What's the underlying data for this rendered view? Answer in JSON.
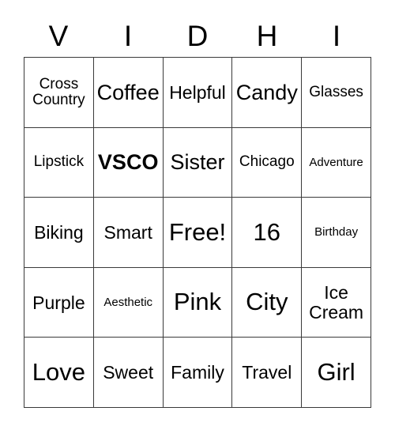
{
  "card": {
    "headers": [
      "V",
      "I",
      "D",
      "H",
      "I"
    ],
    "rows": [
      [
        {
          "label": "Cross\nCountry",
          "size": "sz-sm",
          "bold": false
        },
        {
          "label": "Coffee",
          "size": "sz-lg",
          "bold": false
        },
        {
          "label": "Helpful",
          "size": "sz-md",
          "bold": false
        },
        {
          "label": "Candy",
          "size": "sz-lg",
          "bold": false
        },
        {
          "label": "Glasses",
          "size": "sz-sm",
          "bold": false
        }
      ],
      [
        {
          "label": "Lipstick",
          "size": "sz-sm",
          "bold": false
        },
        {
          "label": "VSCO",
          "size": "sz-lg",
          "bold": true
        },
        {
          "label": "Sister",
          "size": "sz-lg",
          "bold": false
        },
        {
          "label": "Chicago",
          "size": "sz-sm",
          "bold": false
        },
        {
          "label": "Adventure",
          "size": "sz-xs",
          "bold": false
        }
      ],
      [
        {
          "label": "Biking",
          "size": "sz-md",
          "bold": false
        },
        {
          "label": "Smart",
          "size": "sz-md",
          "bold": false
        },
        {
          "label": "Free!",
          "size": "sz-xl",
          "bold": false
        },
        {
          "label": "16",
          "size": "sz-xl",
          "bold": false
        },
        {
          "label": "Birthday",
          "size": "sz-xs",
          "bold": false
        }
      ],
      [
        {
          "label": "Purple",
          "size": "sz-md",
          "bold": false
        },
        {
          "label": "Aesthetic",
          "size": "sz-xs",
          "bold": false
        },
        {
          "label": "Pink",
          "size": "sz-xl",
          "bold": false
        },
        {
          "label": "City",
          "size": "sz-xl",
          "bold": false
        },
        {
          "label": "Ice\nCream",
          "size": "sz-md",
          "bold": false
        }
      ],
      [
        {
          "label": "Love",
          "size": "sz-xl",
          "bold": false
        },
        {
          "label": "Sweet",
          "size": "sz-md",
          "bold": false
        },
        {
          "label": "Family",
          "size": "sz-md",
          "bold": false
        },
        {
          "label": "Travel",
          "size": "sz-md",
          "bold": false
        },
        {
          "label": "Girl",
          "size": "sz-xl",
          "bold": false
        }
      ]
    ]
  }
}
